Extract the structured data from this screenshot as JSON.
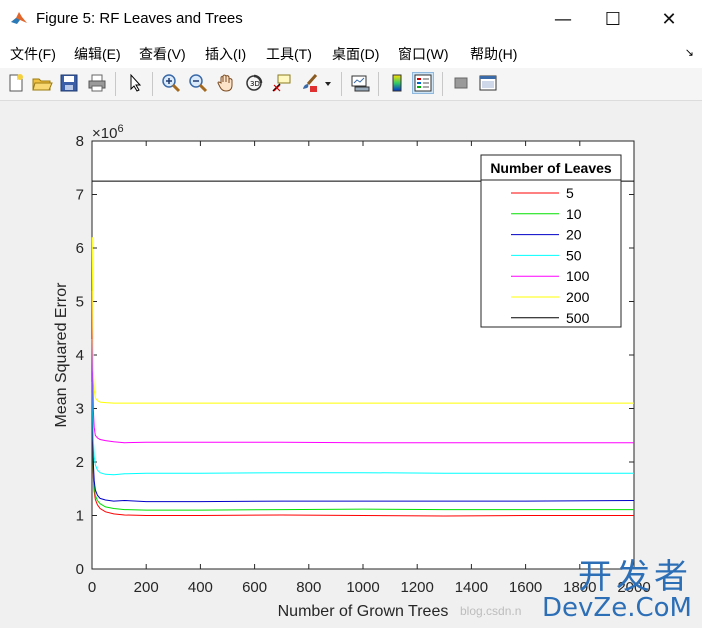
{
  "window": {
    "title": "Figure 5: RF Leaves and Trees"
  },
  "window_controls": {
    "minimize": "—",
    "maximize": "☐",
    "close": "✕"
  },
  "menu": [
    {
      "label": "文件(F)"
    },
    {
      "label": "编辑(E)"
    },
    {
      "label": "查看(V)"
    },
    {
      "label": "插入(I)"
    },
    {
      "label": "工具(T)"
    },
    {
      "label": "桌面(D)"
    },
    {
      "label": "窗口(W)"
    },
    {
      "label": "帮助(H)"
    }
  ],
  "menu_overflow": "↘",
  "toolbar": [
    {
      "icon": "new-figure-icon"
    },
    {
      "icon": "open-file-icon"
    },
    {
      "icon": "save-icon"
    },
    {
      "icon": "print-icon"
    },
    {
      "icon": "pointer-icon"
    },
    {
      "icon": "zoom-in-icon"
    },
    {
      "icon": "zoom-out-icon"
    },
    {
      "icon": "pan-hand-icon"
    },
    {
      "icon": "rotate-3d-icon"
    },
    {
      "icon": "data-cursor-icon"
    },
    {
      "icon": "brush-icon"
    },
    {
      "icon": "dropdown-arrow-icon"
    },
    {
      "icon": "link-plot-icon"
    },
    {
      "icon": "colorbar-icon"
    },
    {
      "icon": "legend-icon"
    },
    {
      "icon": "hide-plot-tools-icon"
    },
    {
      "icon": "show-plot-tools-icon"
    }
  ],
  "chart_data": {
    "type": "line",
    "xlabel": "Number of Grown Trees",
    "ylabel": "Mean Squared Error",
    "y_multiplier": "×10^6",
    "y_multiplier_base": "×10",
    "y_multiplier_exp": "6",
    "xlim": [
      0,
      2000
    ],
    "ylim": [
      0,
      8000000
    ],
    "xticks": [
      "0",
      "200",
      "400",
      "600",
      "800",
      "1000",
      "1200",
      "1400",
      "1600",
      "1800",
      "2000"
    ],
    "yticks": [
      "0",
      "1",
      "2",
      "3",
      "4",
      "5",
      "6",
      "7",
      "8"
    ],
    "grid": false,
    "legend": {
      "title": "Number of Leaves",
      "placement": "top-right"
    },
    "x": [
      1,
      3,
      5,
      8,
      12,
      20,
      30,
      50,
      80,
      120,
      200,
      400,
      700,
      1000,
      1300,
      1600,
      2000
    ],
    "series": [
      {
        "name": "5",
        "color": "#ff0000",
        "values": [
          3300000,
          2200000,
          1700000,
          1450000,
          1300000,
          1200000,
          1130000,
          1070000,
          1030000,
          1010000,
          1000000,
          1000000,
          1010000,
          1000000,
          990000,
          1000000,
          1000000
        ]
      },
      {
        "name": "10",
        "color": "#00e000",
        "values": [
          3500000,
          2300000,
          1800000,
          1550000,
          1380000,
          1280000,
          1220000,
          1160000,
          1130000,
          1110000,
          1100000,
          1100000,
          1110000,
          1120000,
          1110000,
          1110000,
          1110000
        ]
      },
      {
        "name": "20",
        "color": "#0000c8",
        "values": [
          3700000,
          2500000,
          1950000,
          1650000,
          1480000,
          1380000,
          1320000,
          1290000,
          1270000,
          1280000,
          1260000,
          1260000,
          1270000,
          1270000,
          1270000,
          1270000,
          1280000
        ]
      },
      {
        "name": "50",
        "color": "#00ffff",
        "values": [
          4300000,
          3000000,
          2400000,
          2100000,
          1950000,
          1850000,
          1800000,
          1770000,
          1760000,
          1780000,
          1790000,
          1790000,
          1800000,
          1800000,
          1790000,
          1790000,
          1790000
        ]
      },
      {
        "name": "100",
        "color": "#ff00ff",
        "values": [
          5200000,
          3600000,
          2950000,
          2650000,
          2500000,
          2450000,
          2420000,
          2400000,
          2380000,
          2360000,
          2370000,
          2370000,
          2370000,
          2360000,
          2360000,
          2360000,
          2360000
        ]
      },
      {
        "name": "200",
        "color": "#ffff00",
        "values": [
          6200000,
          4500000,
          3700000,
          3350000,
          3200000,
          3150000,
          3120000,
          3110000,
          3100000,
          3100000,
          3100000,
          3100000,
          3100000,
          3100000,
          3100000,
          3100000,
          3100000
        ]
      },
      {
        "name": "500",
        "color": "#000000",
        "values": [
          7250000,
          7250000,
          7250000,
          7250000,
          7250000,
          7250000,
          7250000,
          7250000,
          7250000,
          7250000,
          7250000,
          7250000,
          7250000,
          7250000,
          7250000,
          7250000,
          7250000
        ]
      }
    ]
  },
  "watermark": {
    "cn": "开发者",
    "en": "DevZe.CoM",
    "csdn": "blog.csdn.n"
  }
}
